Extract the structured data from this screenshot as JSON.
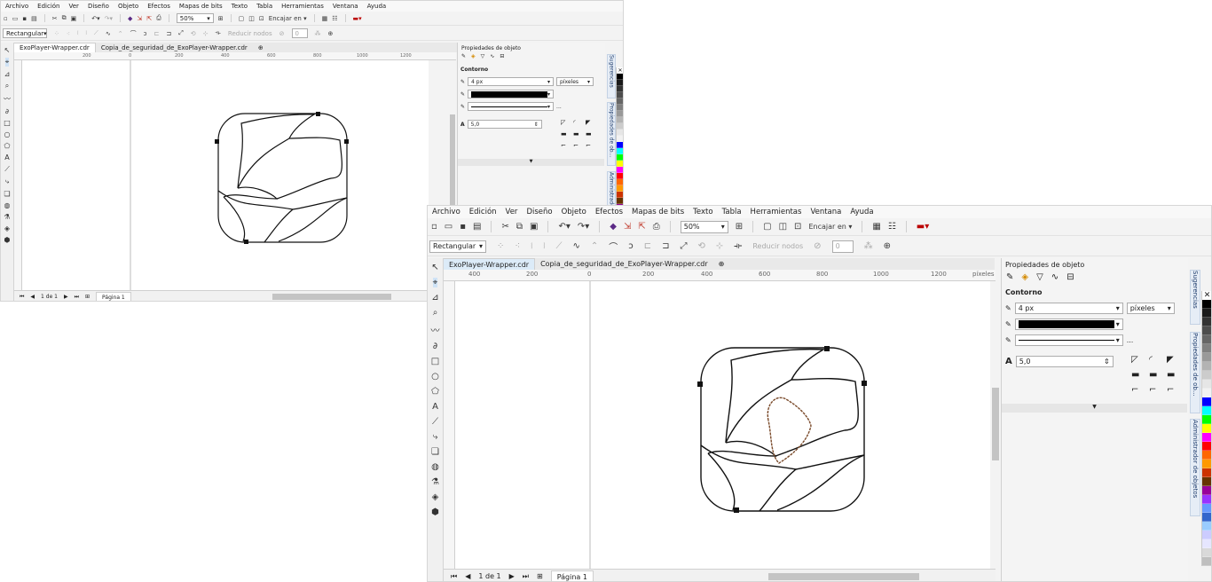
{
  "menu": [
    "Archivo",
    "Edición",
    "Ver",
    "Diseño",
    "Objeto",
    "Efectos",
    "Mapas de bits",
    "Texto",
    "Tabla",
    "Herramientas",
    "Ventana",
    "Ayuda"
  ],
  "toolbar": {
    "zoom": "50%",
    "snap_label": "Encajar en",
    "shape_mode": "Rectangular",
    "reduce_nodes": "Reducir nodos",
    "smooth_value": "0"
  },
  "tabs": [
    "ExoPlayer-Wrapper.cdr",
    "Copia_de_seguridad_de_ExoPlayer-Wrapper.cdr"
  ],
  "ruler": {
    "h_labels": [
      "400",
      "200",
      "0",
      "200",
      "400",
      "600",
      "800",
      "1000",
      "1200"
    ],
    "h_unit": "píxeles",
    "v_labels_small": [
      "1400",
      "1200",
      "1000",
      "800",
      "600",
      "400",
      "200"
    ],
    "v_labels_big": [
      "1400",
      "1200",
      "1000",
      "800",
      "600",
      "400"
    ]
  },
  "docker": {
    "title": "Propiedades de objeto",
    "section": "Contorno",
    "width": "4 px",
    "units": "píxeles",
    "miter": "5,0",
    "dots": "..."
  },
  "side_tabs": [
    "Sugerencias",
    "Propiedades de ob...",
    "Administrador de objetos"
  ],
  "status": {
    "pages": "1 de 1",
    "page_tab": "Página 1"
  },
  "palette": [
    "#ffffff",
    "#000000",
    "#1a1a1a",
    "#333333",
    "#4d4d4d",
    "#666666",
    "#808080",
    "#999999",
    "#b3b3b3",
    "#cccccc",
    "#e6e6e6",
    "#f2f2f2",
    "#0000ff",
    "#00ffff",
    "#00ff00",
    "#ffff00",
    "#ff00ff",
    "#ff0000",
    "#ff6600",
    "#ff9900",
    "#cc3300",
    "#663300",
    "#990099",
    "#9933ff",
    "#6699ff",
    "#3366cc",
    "#99ccff",
    "#ccccff",
    "#e6e6ff",
    "#d9d9d9",
    "#bfbfbf"
  ],
  "icons": {
    "pick": "pick-tool-icon",
    "shape": "shape-tool-icon",
    "crop": "crop-tool-icon",
    "zoom": "zoom-tool-icon",
    "freehand": "freehand-tool-icon",
    "artistic": "artistic-media-icon",
    "rect": "rectangle-tool-icon",
    "ellipse": "ellipse-tool-icon",
    "polygon": "polygon-tool-icon",
    "text": "text-tool-icon",
    "line": "parallel-dimension-icon",
    "connector": "connector-icon",
    "shadow": "drop-shadow-icon",
    "transparency": "transparency-icon",
    "eyedropper": "eyedropper-icon",
    "fill": "interactive-fill-icon",
    "smart": "smart-fill-icon",
    "add": "add-icon"
  }
}
